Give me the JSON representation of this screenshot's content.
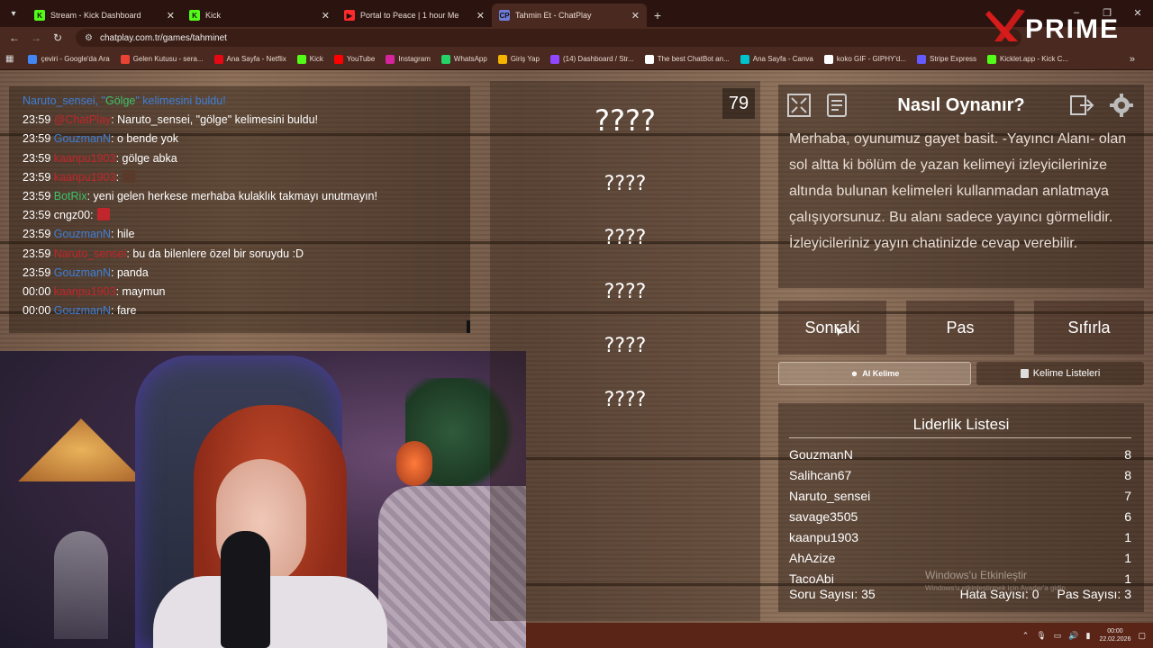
{
  "browser": {
    "tabs": [
      {
        "title": "Stream - Kick Dashboard",
        "favicon_color": "#53fc18",
        "favicon_text": "K",
        "active": false
      },
      {
        "title": "Kick",
        "favicon_color": "#53fc18",
        "favicon_text": "K",
        "active": false
      },
      {
        "title": "Portal to Peace | 1 hour Me",
        "favicon_color": "#ff2a2a",
        "favicon_text": "▶",
        "active": false
      },
      {
        "title": "Tahmin Et - ChatPlay",
        "favicon_color": "#6f7bd8",
        "favicon_text": "CP",
        "active": true
      }
    ],
    "url": "chatplay.com.tr/games/tahminet",
    "bookmarks": [
      {
        "label": "çeviri - Google'da Ara",
        "color": "#4285f4"
      },
      {
        "label": "Gelen Kutusu - sera...",
        "color": "#ea4335"
      },
      {
        "label": "Ana Sayfa - Netflix",
        "color": "#e50914"
      },
      {
        "label": "Kick",
        "color": "#53fc18"
      },
      {
        "label": "YouTube",
        "color": "#ff0000"
      },
      {
        "label": "Instagram",
        "color": "#d6249f"
      },
      {
        "label": "WhatsApp",
        "color": "#25d366"
      },
      {
        "label": "Giriş Yap",
        "color": "#f4b400"
      },
      {
        "label": "(14) Dashboard / Str...",
        "color": "#9146ff"
      },
      {
        "label": "The best ChatBot an...",
        "color": "#ffffff"
      },
      {
        "label": "Ana Sayfa - Canva",
        "color": "#00c4cc"
      },
      {
        "label": "koko GIF - GIPHY'd...",
        "color": "#ffffff"
      },
      {
        "label": "Stripe Express",
        "color": "#635bff"
      },
      {
        "label": "Kicklet.app - Kick C...",
        "color": "#53fc18"
      }
    ]
  },
  "chat": {
    "lines": [
      {
        "time": "",
        "user": "",
        "user_color": "#3d7fd8",
        "pre": "Naruto_sensei, \"",
        "highlight": "Gölge",
        "post": "\" kelimesini buldu!",
        "msg": ""
      },
      {
        "time": "23:59",
        "user": "@ChatPlay",
        "user_color": "#c0262b",
        "msg": ": Naruto_sensei, \"gölge\" kelimesini buldu!"
      },
      {
        "time": "23:59",
        "user": "GouzmanN",
        "user_color": "#3d7fd8",
        "msg": ": o bende yok"
      },
      {
        "time": "23:59",
        "user": "kaanpu1903",
        "user_color": "#c0262b",
        "msg": ": gölge abka"
      },
      {
        "time": "23:59",
        "user": "kaanpu1903",
        "user_color": "#c0262b",
        "msg": ":",
        "emote": "#5a3a2a"
      },
      {
        "time": "23:59",
        "user": "BotRix",
        "user_color": "#3cc26a",
        "msg": ": yeni gelen herkese merhaba kulaklık takmayı unutmayın!"
      },
      {
        "time": "23:59",
        "user": "cngz00",
        "user_color": "#ffffff",
        "msg": ":",
        "emote": "#c0262b"
      },
      {
        "time": "23:59",
        "user": "GouzmanN",
        "user_color": "#3d7fd8",
        "msg": ": hile"
      },
      {
        "time": "23:59",
        "user": "Naruto_sensei",
        "user_color": "#c0262b",
        "msg": ": bu da bilenlere özel bir soruydu :D"
      },
      {
        "time": "23:59",
        "user": "GouzmanN",
        "user_color": "#3d7fd8",
        "msg": ": panda"
      },
      {
        "time": "00:00",
        "user": "kaanpu1903",
        "user_color": "#c0262b",
        "msg": ": maymun"
      },
      {
        "time": "00:00",
        "user": "GouzmanN",
        "user_color": "#3d7fd8",
        "msg": ": fare"
      }
    ]
  },
  "game": {
    "counter": "79",
    "main_word": "????",
    "words": [
      "????",
      "????",
      "????",
      "????",
      "????"
    ]
  },
  "howto": {
    "title": "Nasıl Oynanır?",
    "text": "Merhaba, oyunumuz gayet basit. -Yayıncı Alanı- olan sol altta ki bölüm de yazan kelimeyi izleyicilerinize altında bulunan kelimeleri kullanmadan anlatmaya çalışıyorsunuz. Bu alanı sadece yayıncı görmelidir. İzleyicileriniz yayın chatinizde cevap verebilir."
  },
  "actions": {
    "next": "Sonraki",
    "pass": "Pas",
    "reset": "Sıfırla",
    "ai_word": "AI Kelime",
    "word_lists": "Kelime Listeleri"
  },
  "leaderboard": {
    "title": "Liderlik Listesi",
    "rows": [
      {
        "name": "GouzmanN",
        "score": "8"
      },
      {
        "name": "Salihcan67",
        "score": "8"
      },
      {
        "name": "Naruto_sensei",
        "score": "7"
      },
      {
        "name": "savage3505",
        "score": "6"
      },
      {
        "name": "kaanpu1903",
        "score": "1"
      },
      {
        "name": "AhAzize",
        "score": "1"
      },
      {
        "name": "TacoAbi",
        "score": "1"
      }
    ],
    "question_count": "Soru Sayısı: 35",
    "error_count": "Hata Sayısı: 0",
    "pass_count": "Pas Sayısı: 3"
  },
  "watermark": {
    "line1": "Windows'u Etkinleştir",
    "line2": "Windows'u etkinleştirmek için Ayarlar'a gidin."
  },
  "taskbar": {
    "time": "00:00",
    "date": "22.02.2026"
  },
  "logo": {
    "text": "XPRIME"
  }
}
